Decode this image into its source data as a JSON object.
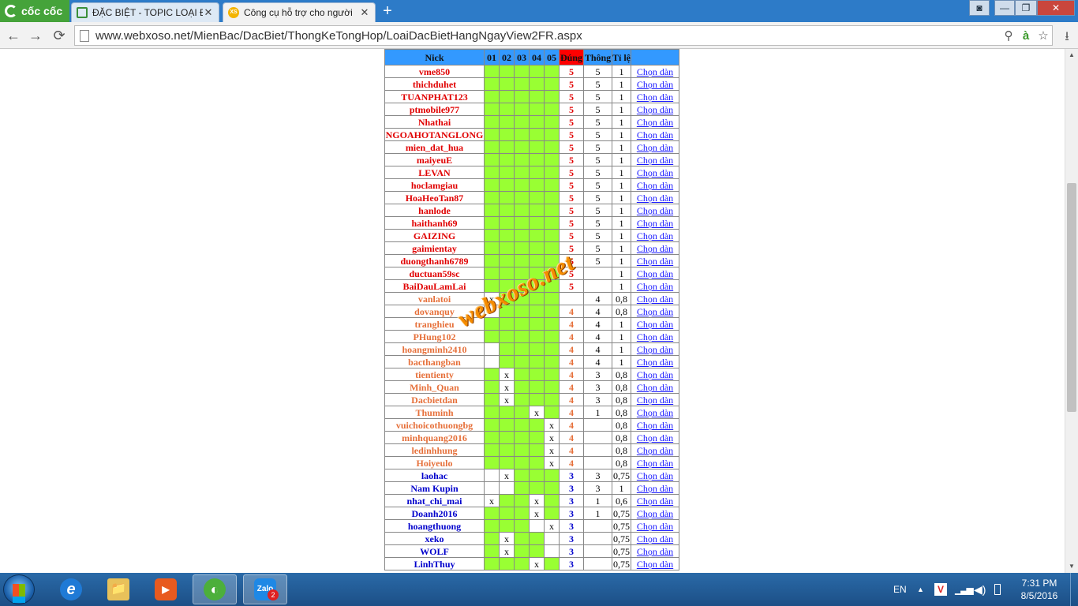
{
  "browser": {
    "brand": "cốc cốc",
    "tabs": [
      {
        "title": "ĐẶC BIỆT - TOPIC LOẠI ĐẶ",
        "close": "✕",
        "active": false
      },
      {
        "title": "Công cụ hỗ trợ cho người",
        "close": "✕",
        "active": true
      }
    ],
    "new_tab": "+",
    "url": "www.webxoso.net/MienBac/DacBiet/ThongKeTongHop/LoaiDacBietHangNgayView2FR.aspx",
    "buttons": {
      "back": "←",
      "forward": "→",
      "reload": "⟳",
      "zoom": "⚲",
      "vietnamese": "à",
      "star": "☆",
      "download": "⭳"
    },
    "window": {
      "minimize": "—",
      "maximize": "❐",
      "close": "✕",
      "user": "👤"
    }
  },
  "table": {
    "headers": {
      "nick": "Nick",
      "n1": "01",
      "n2": "02",
      "n3": "03",
      "n4": "04",
      "n5": "05",
      "dung": "Đúng",
      "thong": "Thông",
      "tile": "Tỉ lệ"
    },
    "link_label": "Chọn dàn",
    "rows": [
      {
        "nick": "vme850",
        "c": [
          "g",
          "g",
          "g",
          "g",
          "g"
        ],
        "dung": "5",
        "thong": "5",
        "tile": "1",
        "lv": "lv5"
      },
      {
        "nick": "thichduhet",
        "c": [
          "g",
          "g",
          "g",
          "g",
          "g"
        ],
        "dung": "5",
        "thong": "5",
        "tile": "1",
        "lv": "lv5"
      },
      {
        "nick": "TUANPHAT123",
        "c": [
          "g",
          "g",
          "g",
          "g",
          "g"
        ],
        "dung": "5",
        "thong": "5",
        "tile": "1",
        "lv": "lv5"
      },
      {
        "nick": "ptmobile977",
        "c": [
          "g",
          "g",
          "g",
          "g",
          "g"
        ],
        "dung": "5",
        "thong": "5",
        "tile": "1",
        "lv": "lv5"
      },
      {
        "nick": "Nhathai",
        "c": [
          "g",
          "g",
          "g",
          "g",
          "g"
        ],
        "dung": "5",
        "thong": "5",
        "tile": "1",
        "lv": "lv5"
      },
      {
        "nick": "NGOAHOTANGLONG",
        "c": [
          "g",
          "g",
          "g",
          "g",
          "g"
        ],
        "dung": "5",
        "thong": "5",
        "tile": "1",
        "lv": "lv5"
      },
      {
        "nick": "mien_dat_hua",
        "c": [
          "g",
          "g",
          "g",
          "g",
          "g"
        ],
        "dung": "5",
        "thong": "5",
        "tile": "1",
        "lv": "lv5"
      },
      {
        "nick": "maiyeuE",
        "c": [
          "g",
          "g",
          "g",
          "g",
          "g"
        ],
        "dung": "5",
        "thong": "5",
        "tile": "1",
        "lv": "lv5"
      },
      {
        "nick": "LEVAN",
        "c": [
          "g",
          "g",
          "g",
          "g",
          "g"
        ],
        "dung": "5",
        "thong": "5",
        "tile": "1",
        "lv": "lv5"
      },
      {
        "nick": "hoclamgiau",
        "c": [
          "g",
          "g",
          "g",
          "g",
          "g"
        ],
        "dung": "5",
        "thong": "5",
        "tile": "1",
        "lv": "lv5"
      },
      {
        "nick": "HoaHeoTan87",
        "c": [
          "g",
          "g",
          "g",
          "g",
          "g"
        ],
        "dung": "5",
        "thong": "5",
        "tile": "1",
        "lv": "lv5"
      },
      {
        "nick": "hanlode",
        "c": [
          "g",
          "g",
          "g",
          "g",
          "g"
        ],
        "dung": "5",
        "thong": "5",
        "tile": "1",
        "lv": "lv5"
      },
      {
        "nick": "haithanh69",
        "c": [
          "g",
          "g",
          "g",
          "g",
          "g"
        ],
        "dung": "5",
        "thong": "5",
        "tile": "1",
        "lv": "lv5"
      },
      {
        "nick": "GAIZING",
        "c": [
          "g",
          "g",
          "g",
          "g",
          "g"
        ],
        "dung": "5",
        "thong": "5",
        "tile": "1",
        "lv": "lv5"
      },
      {
        "nick": "gaimientay",
        "c": [
          "g",
          "g",
          "g",
          "g",
          "g"
        ],
        "dung": "5",
        "thong": "5",
        "tile": "1",
        "lv": "lv5"
      },
      {
        "nick": "duongthanh6789",
        "c": [
          "g",
          "g",
          "g",
          "g",
          "g"
        ],
        "dung": "5",
        "thong": "5",
        "tile": "1",
        "lv": "lv5"
      },
      {
        "nick": "ductuan59sc",
        "c": [
          "g",
          "g",
          "g",
          "g",
          "g"
        ],
        "dung": "5",
        "thong": "",
        "tile": "1",
        "lv": "lv5"
      },
      {
        "nick": "BaiDauLamLai",
        "c": [
          "g",
          "g",
          "g",
          "g",
          "g"
        ],
        "dung": "5",
        "thong": "",
        "tile": "1",
        "lv": "lv5"
      },
      {
        "nick": "vanlatoi",
        "c": [
          "x",
          "g",
          "g",
          "g",
          "g"
        ],
        "dung": "",
        "thong": "4",
        "tile": "0,8",
        "lv": "lv4"
      },
      {
        "nick": "dovanquy",
        "c": [
          "w",
          "g",
          "g",
          "g",
          "g"
        ],
        "dung": "4",
        "thong": "4",
        "tile": "0,8",
        "lv": "lv4"
      },
      {
        "nick": "tranghieu",
        "c": [
          "g",
          "g",
          "g",
          "g",
          "g"
        ],
        "dung": "4",
        "thong": "4",
        "tile": "1",
        "lv": "lv4"
      },
      {
        "nick": "PHung102",
        "c": [
          "g",
          "g",
          "g",
          "g",
          "g"
        ],
        "dung": "4",
        "thong": "4",
        "tile": "1",
        "lv": "lv4"
      },
      {
        "nick": "hoangminh2410",
        "c": [
          "w",
          "g",
          "g",
          "g",
          "g"
        ],
        "dung": "4",
        "thong": "4",
        "tile": "1",
        "lv": "lv4"
      },
      {
        "nick": "bacthangban",
        "c": [
          "w",
          "g",
          "g",
          "g",
          "g"
        ],
        "dung": "4",
        "thong": "4",
        "tile": "1",
        "lv": "lv4"
      },
      {
        "nick": "tientienty",
        "c": [
          "g",
          "x",
          "g",
          "g",
          "g"
        ],
        "dung": "4",
        "thong": "3",
        "tile": "0,8",
        "lv": "lv4"
      },
      {
        "nick": "Minh_Quan",
        "c": [
          "g",
          "x",
          "g",
          "g",
          "g"
        ],
        "dung": "4",
        "thong": "3",
        "tile": "0,8",
        "lv": "lv4"
      },
      {
        "nick": "Dacbietdan",
        "c": [
          "g",
          "x",
          "g",
          "g",
          "g"
        ],
        "dung": "4",
        "thong": "3",
        "tile": "0,8",
        "lv": "lv4"
      },
      {
        "nick": "Thuminh",
        "c": [
          "g",
          "g",
          "g",
          "x",
          "g"
        ],
        "dung": "4",
        "thong": "1",
        "tile": "0,8",
        "lv": "lv4"
      },
      {
        "nick": "vuichoicothuongbg",
        "c": [
          "g",
          "g",
          "g",
          "g",
          "x"
        ],
        "dung": "4",
        "thong": "",
        "tile": "0,8",
        "lv": "lv4"
      },
      {
        "nick": "minhquang2016",
        "c": [
          "g",
          "g",
          "g",
          "g",
          "x"
        ],
        "dung": "4",
        "thong": "",
        "tile": "0,8",
        "lv": "lv4"
      },
      {
        "nick": "ledinhhung",
        "c": [
          "g",
          "g",
          "g",
          "g",
          "x"
        ],
        "dung": "4",
        "thong": "",
        "tile": "0,8",
        "lv": "lv4"
      },
      {
        "nick": "Hoiyeulo",
        "c": [
          "g",
          "g",
          "g",
          "g",
          "x"
        ],
        "dung": "4",
        "thong": "",
        "tile": "0,8",
        "lv": "lv4"
      },
      {
        "nick": "laohac",
        "c": [
          "w",
          "x",
          "g",
          "g",
          "g"
        ],
        "dung": "3",
        "thong": "3",
        "tile": "0,75",
        "lv": "lv3"
      },
      {
        "nick": "Nam Kupin",
        "c": [
          "w",
          "w",
          "g",
          "g",
          "g"
        ],
        "dung": "3",
        "thong": "3",
        "tile": "1",
        "lv": "lv3"
      },
      {
        "nick": "nhat_chi_mai",
        "c": [
          "x",
          "g",
          "g",
          "x",
          "g"
        ],
        "dung": "3",
        "thong": "1",
        "tile": "0,6",
        "lv": "lv3"
      },
      {
        "nick": "Doanh2016",
        "c": [
          "g",
          "g",
          "g",
          "x",
          "g"
        ],
        "dung": "3",
        "thong": "1",
        "tile": "0,75",
        "lv": "lv3"
      },
      {
        "nick": "hoangthuong",
        "c": [
          "g",
          "g",
          "g",
          "w",
          "x"
        ],
        "dung": "3",
        "thong": "",
        "tile": "0,75",
        "lv": "lv3"
      },
      {
        "nick": "xeko",
        "c": [
          "g",
          "x",
          "g",
          "g",
          "w"
        ],
        "dung": "3",
        "thong": "",
        "tile": "0,75",
        "lv": "lv3"
      },
      {
        "nick": "WOLF",
        "c": [
          "g",
          "x",
          "g",
          "g",
          "w"
        ],
        "dung": "3",
        "thong": "",
        "tile": "0,75",
        "lv": "lv3"
      },
      {
        "nick": "LinhThuy",
        "c": [
          "g",
          "g",
          "g",
          "x",
          "g"
        ],
        "dung": "3",
        "thong": "",
        "tile": "0,75",
        "lv": "lv3"
      }
    ]
  },
  "watermark": "webxoso.net",
  "taskbar": {
    "apps": [
      "e",
      "📁",
      "▶",
      "◐",
      "Zalo"
    ],
    "zalo_badge": "2",
    "lang": "EN",
    "time": "7:31 PM",
    "date": "8/5/2016"
  },
  "colors": {
    "green": "#99ff33",
    "header": "#3399ff",
    "dung_header": "#ff0000",
    "lv5": "#e00000",
    "lv4": "#e6703a",
    "lv3": "#0000cc"
  }
}
